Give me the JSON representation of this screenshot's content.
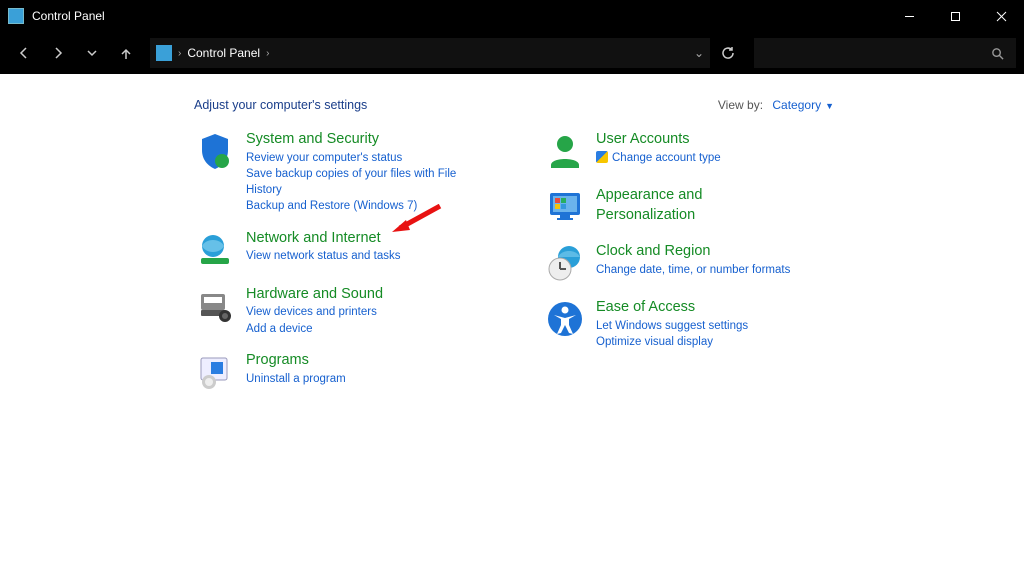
{
  "window": {
    "title": "Control Panel"
  },
  "breadcrumb": {
    "root": "Control Panel"
  },
  "content": {
    "heading": "Adjust your computer's settings",
    "viewby_label": "View by:",
    "viewby_value": "Category"
  },
  "left": {
    "system": {
      "title": "System and Security",
      "links": [
        "Review your computer's status",
        "Save backup copies of your files with File History",
        "Backup and Restore (Windows 7)"
      ]
    },
    "network": {
      "title": "Network and Internet",
      "links": [
        "View network status and tasks"
      ]
    },
    "hardware": {
      "title": "Hardware and Sound",
      "links": [
        "View devices and printers",
        "Add a device"
      ]
    },
    "programs": {
      "title": "Programs",
      "links": [
        "Uninstall a program"
      ]
    }
  },
  "right": {
    "users": {
      "title": "User Accounts",
      "links": [
        "Change account type"
      ]
    },
    "appearance": {
      "title": "Appearance and Personalization"
    },
    "clock": {
      "title": "Clock and Region",
      "links": [
        "Change date, time, or number formats"
      ]
    },
    "ease": {
      "title": "Ease of Access",
      "links": [
        "Let Windows suggest settings",
        "Optimize visual display"
      ]
    }
  }
}
